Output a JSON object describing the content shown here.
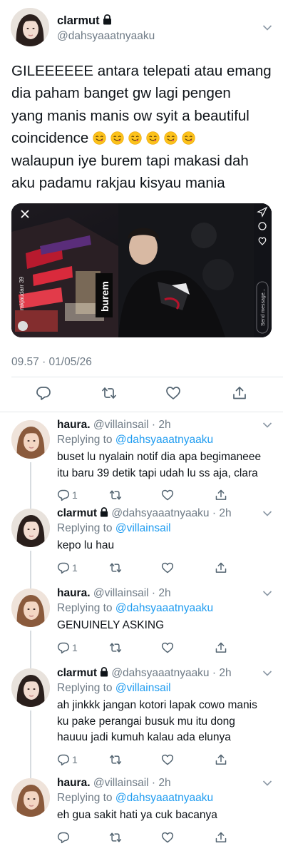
{
  "main_tweet": {
    "display_name": "clarmut",
    "handle": "@dahsyaaatnyaaku",
    "text_line1": "GILEEEEEE antara telepati atau emang",
    "text_line2": "dia paham banget gw lagi pengen",
    "text_line3": "yang manis manis ow syit a beautiful",
    "text_line4": "coincidence",
    "text_line5": "walaupun iye burem tapi makasi dah",
    "text_line6": "aku padamu rakjau kisyau mania",
    "emoji_count": 6,
    "emoji_name": "face-savoring-food",
    "timestamp": "09.57 · 01/05/26",
    "media": {
      "story_caption": "burem",
      "username_vertical": "rakjaudarr 39",
      "message_placeholder": "Send message..."
    }
  },
  "replies": [
    {
      "display_name": "haura.",
      "meta": "@villainsail · 2h",
      "replying_prefix": "Replying to ",
      "replying_to": "@dahsyaaatnyaaku",
      "line1": "buset lu nyalain notif dia apa begimaneee",
      "line2": "itu baru 39 detik tapi udah lu ss aja, clara",
      "line3": "",
      "reply_count": "1",
      "locked": false
    },
    {
      "display_name": "clarmut",
      "meta": "@dahsyaaatnyaaku · 2h",
      "replying_prefix": "Replying to ",
      "replying_to": "@villainsail",
      "line1": "kepo lu hau",
      "line2": "",
      "line3": "",
      "reply_count": "1",
      "locked": true
    },
    {
      "display_name": "haura.",
      "meta": "@villainsail · 2h",
      "replying_prefix": "Replying to ",
      "replying_to": "@dahsyaaatnyaaku",
      "line1": "GENUINELY ASKING",
      "line2": "",
      "line3": "",
      "reply_count": "1",
      "locked": false
    },
    {
      "display_name": "clarmut",
      "meta": "@dahsyaaatnyaaku · 2h",
      "replying_prefix": "Replying to ",
      "replying_to": "@villainsail",
      "line1": "ah jinkkk jangan kotori lapak cowo manis",
      "line2": "ku pake perangai busuk mu itu dong",
      "line3": "hauuu jadi kumuh kalau ada elunya",
      "reply_count": "1",
      "locked": true
    },
    {
      "display_name": "haura.",
      "meta": "@villainsail · 2h",
      "replying_prefix": "Replying to ",
      "replying_to": "@dahsyaaatnyaaku",
      "line1": "eh gua sakit hati ya cuk bacanya",
      "line2": "",
      "line3": "",
      "reply_count": "",
      "locked": false
    }
  ],
  "colors": {
    "text": "#0f1419",
    "secondary": "#6f7b86",
    "link": "#1d9bf0",
    "divider": "#e3e7ea"
  }
}
